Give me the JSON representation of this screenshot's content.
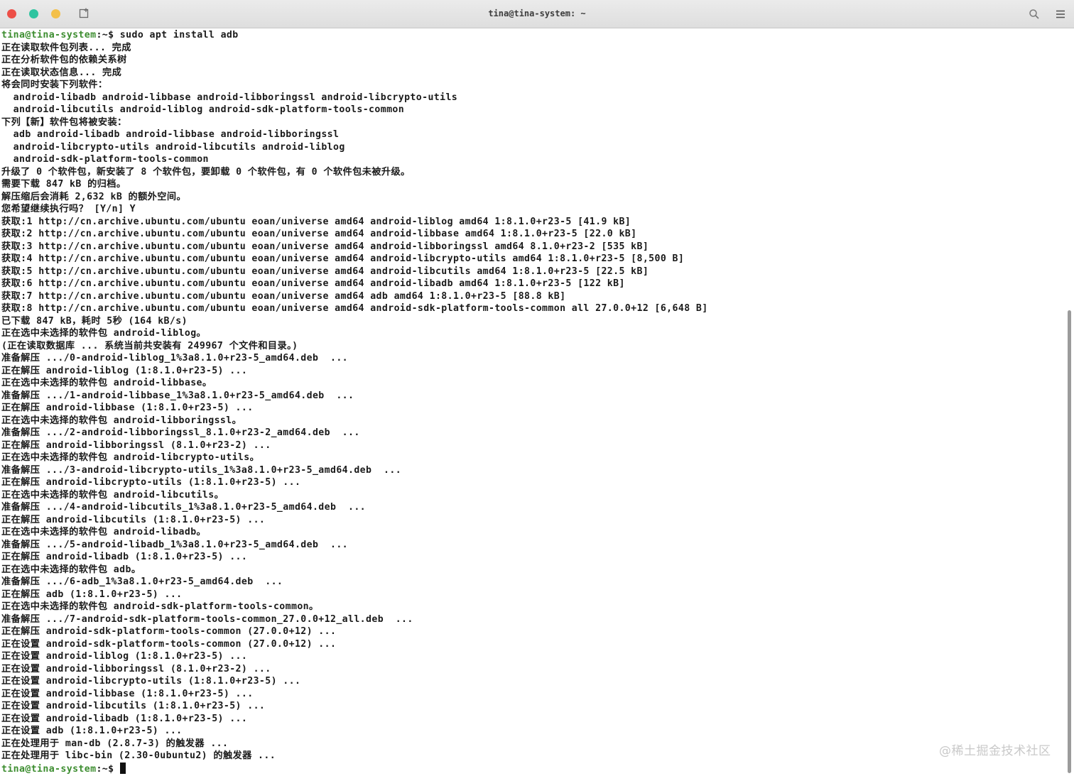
{
  "window": {
    "title": "tina@tina-system: ~"
  },
  "terminal": {
    "prompt_user": "tina@tina-system",
    "prompt_path": ":~$ ",
    "command": "sudo apt install adb",
    "lines": [
      "正在读取软件包列表... 完成",
      "正在分析软件包的依赖关系树",
      "正在读取状态信息... 完成",
      "将会同时安装下列软件：",
      "  android-libadb android-libbase android-libboringssl android-libcrypto-utils",
      "  android-libcutils android-liblog android-sdk-platform-tools-common",
      "下列【新】软件包将被安装：",
      "  adb android-libadb android-libbase android-libboringssl",
      "  android-libcrypto-utils android-libcutils android-liblog",
      "  android-sdk-platform-tools-common",
      "升级了 0 个软件包，新安装了 8 个软件包，要卸载 0 个软件包，有 0 个软件包未被升级。",
      "需要下载 847 kB 的归档。",
      "解压缩后会消耗 2,632 kB 的额外空间。",
      "您希望继续执行吗？ [Y/n] Y",
      "获取:1 http://cn.archive.ubuntu.com/ubuntu eoan/universe amd64 android-liblog amd64 1:8.1.0+r23-5 [41.9 kB]",
      "获取:2 http://cn.archive.ubuntu.com/ubuntu eoan/universe amd64 android-libbase amd64 1:8.1.0+r23-5 [22.0 kB]",
      "获取:3 http://cn.archive.ubuntu.com/ubuntu eoan/universe amd64 android-libboringssl amd64 8.1.0+r23-2 [535 kB]",
      "获取:4 http://cn.archive.ubuntu.com/ubuntu eoan/universe amd64 android-libcrypto-utils amd64 1:8.1.0+r23-5 [8,500 B]",
      "获取:5 http://cn.archive.ubuntu.com/ubuntu eoan/universe amd64 android-libcutils amd64 1:8.1.0+r23-5 [22.5 kB]",
      "获取:6 http://cn.archive.ubuntu.com/ubuntu eoan/universe amd64 android-libadb amd64 1:8.1.0+r23-5 [122 kB]",
      "获取:7 http://cn.archive.ubuntu.com/ubuntu eoan/universe amd64 adb amd64 1:8.1.0+r23-5 [88.8 kB]",
      "获取:8 http://cn.archive.ubuntu.com/ubuntu eoan/universe amd64 android-sdk-platform-tools-common all 27.0.0+12 [6,648 B]",
      "已下载 847 kB，耗时 5秒 (164 kB/s)",
      "正在选中未选择的软件包 android-liblog。",
      "(正在读取数据库 ... 系统当前共安装有 249967 个文件和目录。)",
      "准备解压 .../0-android-liblog_1%3a8.1.0+r23-5_amd64.deb  ...",
      "正在解压 android-liblog (1:8.1.0+r23-5) ...",
      "正在选中未选择的软件包 android-libbase。",
      "准备解压 .../1-android-libbase_1%3a8.1.0+r23-5_amd64.deb  ...",
      "正在解压 android-libbase (1:8.1.0+r23-5) ...",
      "正在选中未选择的软件包 android-libboringssl。",
      "准备解压 .../2-android-libboringssl_8.1.0+r23-2_amd64.deb  ...",
      "正在解压 android-libboringssl (8.1.0+r23-2) ...",
      "正在选中未选择的软件包 android-libcrypto-utils。",
      "准备解压 .../3-android-libcrypto-utils_1%3a8.1.0+r23-5_amd64.deb  ...",
      "正在解压 android-libcrypto-utils (1:8.1.0+r23-5) ...",
      "正在选中未选择的软件包 android-libcutils。",
      "准备解压 .../4-android-libcutils_1%3a8.1.0+r23-5_amd64.deb  ...",
      "正在解压 android-libcutils (1:8.1.0+r23-5) ...",
      "正在选中未选择的软件包 android-libadb。",
      "准备解压 .../5-android-libadb_1%3a8.1.0+r23-5_amd64.deb  ...",
      "正在解压 android-libadb (1:8.1.0+r23-5) ...",
      "正在选中未选择的软件包 adb。",
      "准备解压 .../6-adb_1%3a8.1.0+r23-5_amd64.deb  ...",
      "正在解压 adb (1:8.1.0+r23-5) ...",
      "正在选中未选择的软件包 android-sdk-platform-tools-common。",
      "准备解压 .../7-android-sdk-platform-tools-common_27.0.0+12_all.deb  ...",
      "正在解压 android-sdk-platform-tools-common (27.0.0+12) ...",
      "正在设置 android-sdk-platform-tools-common (27.0.0+12) ...",
      "正在设置 android-liblog (1:8.1.0+r23-5) ...",
      "正在设置 android-libboringssl (8.1.0+r23-2) ...",
      "正在设置 android-libcrypto-utils (1:8.1.0+r23-5) ...",
      "正在设置 android-libbase (1:8.1.0+r23-5) ...",
      "正在设置 android-libcutils (1:8.1.0+r23-5) ...",
      "正在设置 android-libadb (1:8.1.0+r23-5) ...",
      "正在设置 adb (1:8.1.0+r23-5) ...",
      "正在处理用于 man-db (2.8.7-3) 的触发器 ...",
      "正在处理用于 libc-bin (2.30-0ubuntu2) 的触发器 ..."
    ]
  },
  "watermark": "@稀土掘金技术社区",
  "icons": {
    "new_tab": "new-tab-icon",
    "search": "search-icon",
    "menu": "hamburger-menu-icon"
  },
  "colors": {
    "prompt": "#3c8d2f",
    "close": "#ed4f47",
    "minimize": "#2fc4a0",
    "maximize": "#f3c04a"
  }
}
